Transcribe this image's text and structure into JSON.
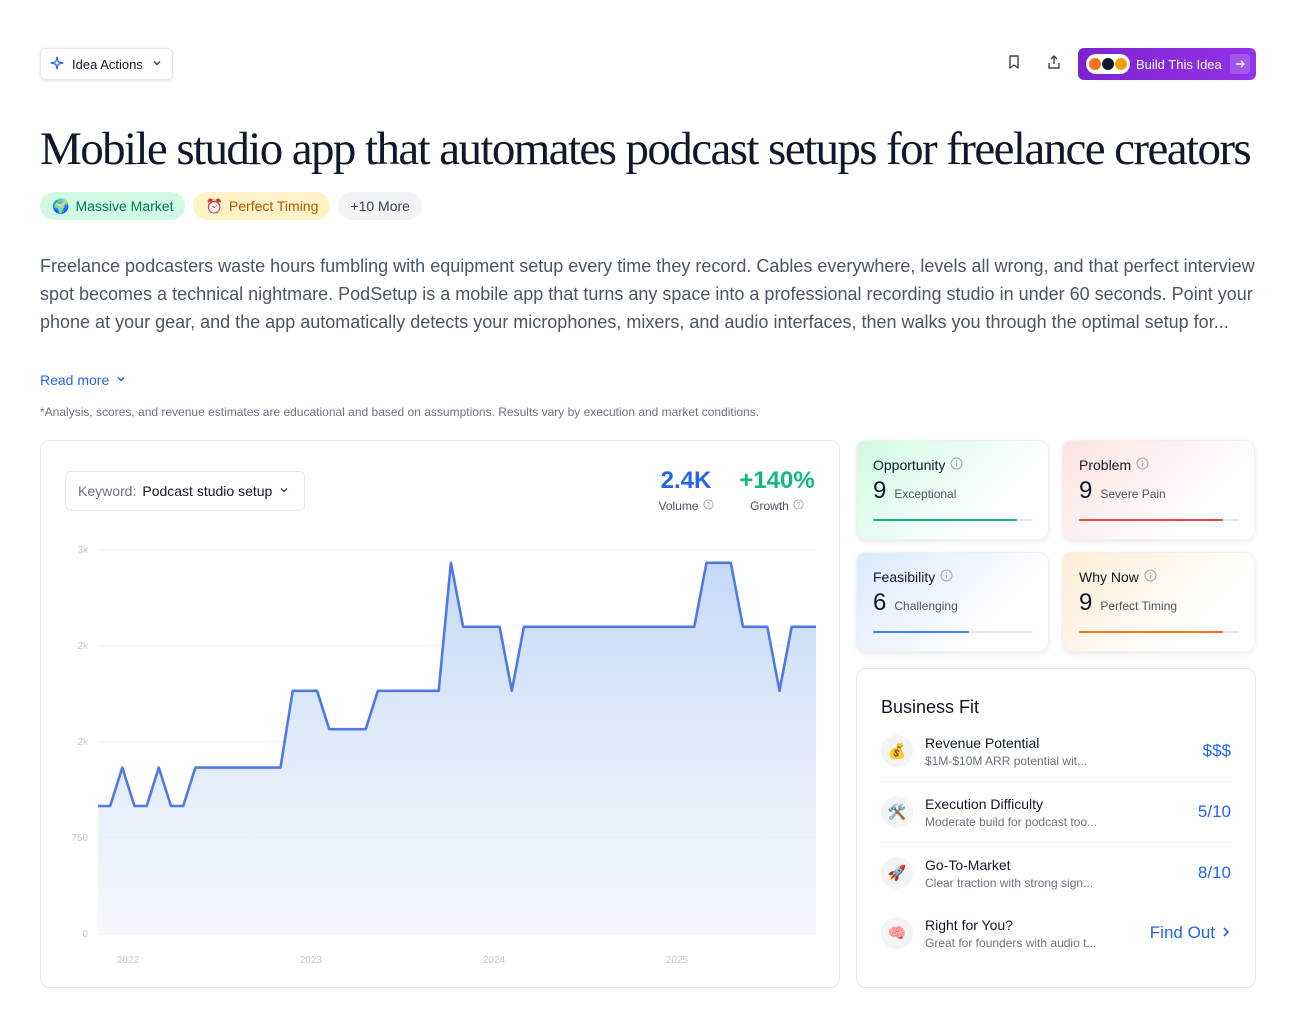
{
  "toolbar": {
    "idea_actions_label": "Idea Actions",
    "build_label": "Build This Idea"
  },
  "title": "Mobile studio app that automates podcast setups for freelance creators",
  "tags": [
    {
      "emoji": "🌍",
      "label": "Massive Market"
    },
    {
      "emoji": "⏰",
      "label": "Perfect Timing"
    },
    {
      "label": "+10 More"
    }
  ],
  "description": "Freelance podcasters waste hours fumbling with equipment setup every time they record. Cables everywhere, levels all wrong, and that perfect interview spot becomes a technical nightmare. PodSetup is a mobile app that turns any space into a professional recording studio in under 60 seconds. Point your phone at your gear, and the app automatically detects your microphones, mixers, and audio interfaces, then walks you through the optimal setup for...",
  "read_more": "Read more",
  "disclaimer": "*Analysis, scores, and revenue estimates are educational and based on assumptions. Results vary by execution and market conditions.",
  "keyword": {
    "label": "Keyword:",
    "value": "Podcast studio setup"
  },
  "stats": {
    "volume": {
      "value": "2.4K",
      "label": "Volume",
      "color": "#2563eb"
    },
    "growth": {
      "value": "+140%",
      "label": "Growth",
      "color": "#10b981"
    }
  },
  "chart_data": {
    "type": "area",
    "y_tick_labels": [
      "0",
      "750",
      "2k",
      "2k",
      "3k"
    ],
    "x_tick_labels": [
      "2022",
      "2023",
      "2024",
      "2025"
    ],
    "ylim": [
      0,
      3000
    ],
    "grid": true,
    "line_color": "#4f7ae6",
    "values": [
      1000,
      1000,
      1300,
      1000,
      1000,
      1300,
      1000,
      1000,
      1300,
      1300,
      1300,
      1300,
      1300,
      1300,
      1300,
      1300,
      1900,
      1900,
      1900,
      1600,
      1600,
      1600,
      1600,
      1900,
      1900,
      1900,
      1900,
      1900,
      1900,
      2900,
      2400,
      2400,
      2400,
      2400,
      1900,
      2400,
      2400,
      2400,
      2400,
      2400,
      2400,
      2400,
      2400,
      2400,
      2400,
      2400,
      2400,
      2400,
      2400,
      2400,
      2900,
      2900,
      2900,
      2400,
      2400,
      2400,
      1900,
      2400,
      2400,
      2400
    ],
    "x_positions": [
      0,
      1,
      2,
      3,
      4,
      5,
      6,
      7,
      8,
      9,
      10,
      11,
      12,
      13,
      14,
      15,
      16,
      17,
      18,
      19,
      20,
      21,
      22,
      23,
      24,
      25,
      26,
      27,
      28,
      29,
      30,
      31,
      32,
      33,
      34,
      35,
      36,
      37,
      38,
      39,
      40,
      41,
      42,
      43,
      44,
      45,
      46,
      47,
      48,
      49,
      50,
      51,
      52,
      53,
      54,
      55,
      56,
      57,
      58,
      59
    ]
  },
  "scores": [
    {
      "name": "Opportunity",
      "value": "9",
      "desc": "Exceptional",
      "fill": 0.9,
      "color": "#10b981",
      "bg": "#ecfdf5"
    },
    {
      "name": "Problem",
      "value": "9",
      "desc": "Severe Pain",
      "fill": 0.9,
      "color": "#ef4444",
      "bg": "#fef2f2"
    },
    {
      "name": "Feasibility",
      "value": "6",
      "desc": "Challenging",
      "fill": 0.6,
      "color": "#3b82f6",
      "bg": "#eff6ff"
    },
    {
      "name": "Why Now",
      "value": "9",
      "desc": "Perfect Timing",
      "fill": 0.9,
      "color": "#f97316",
      "bg": "#fff7ed"
    }
  ],
  "business_fit": {
    "title": "Business Fit",
    "rows": [
      {
        "emoji": "💰",
        "title": "Revenue Potential",
        "sub": "$1M-$10M ARR potential wit...",
        "value": "$$$"
      },
      {
        "emoji": "🛠️",
        "title": "Execution Difficulty",
        "sub": "Moderate build for podcast too...",
        "value": "5/10"
      },
      {
        "emoji": "🚀",
        "title": "Go-To-Market",
        "sub": "Clear traction with strong sign...",
        "value": "8/10"
      },
      {
        "emoji": "🧠",
        "title": "Right for You?",
        "sub": "Great for founders with audio t...",
        "value": "Find Out"
      }
    ]
  }
}
